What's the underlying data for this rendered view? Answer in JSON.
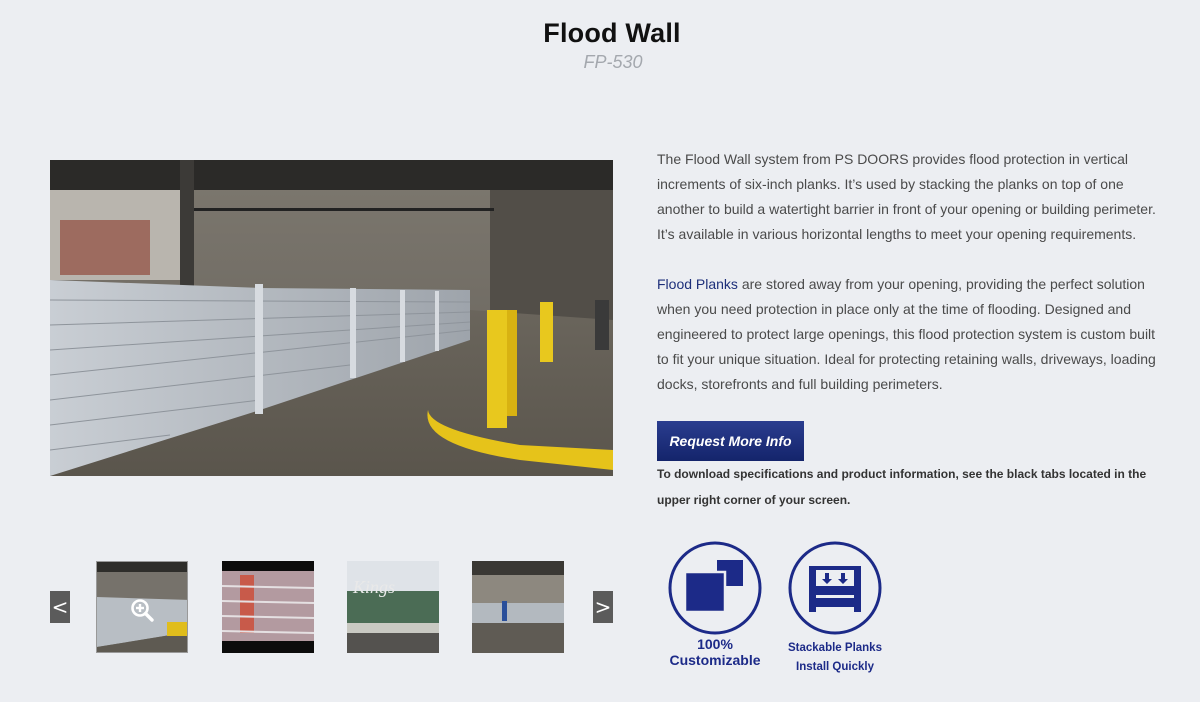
{
  "header": {
    "title": "Flood Wall",
    "model": "FP-530"
  },
  "gallery": {
    "prev_label": "<",
    "next_label": ">",
    "thumbnails": [
      {
        "name": "thumb-flood-wall-garage",
        "active": true
      },
      {
        "name": "thumb-flood-plank-closeup",
        "active": false
      },
      {
        "name": "thumb-kings-storefront",
        "active": false
      },
      {
        "name": "thumb-flood-wall-overview",
        "active": false
      }
    ]
  },
  "description": {
    "paragraph1": "The Flood Wall system from PS DOORS provides flood protection in vertical increments of six-inch planks. It’s used by stacking the planks on top of one another to build a watertight barrier in front of your opening or building perimeter. It’s available in various horizontal lengths to meet your opening requirements.",
    "link_text": "Flood Planks",
    "paragraph2_rest": " are stored away from your opening, providing the perfect solution when you need protection in place only at the time of flooding. Designed and engineered to protect large openings, this flood protection system is custom built to fit your unique situation. Ideal for protecting retaining walls, driveways, loading docks, storefronts and full building perimeters."
  },
  "cta": {
    "label": "Request More Info"
  },
  "note": "To download specifications and product information, see the black tabs located in the upper right corner of your screen.",
  "badges": [
    {
      "line1": "100%",
      "line2": "Customizable",
      "icon": "customizable-icon"
    },
    {
      "line1": "Stackable Planks",
      "line2": "Install Quickly",
      "icon": "stackable-planks-icon"
    }
  ],
  "colors": {
    "background": "#eceef2",
    "brand_blue": "#1c2a88",
    "button_blue": "#1f3180",
    "link_blue": "#1d2f7a"
  }
}
